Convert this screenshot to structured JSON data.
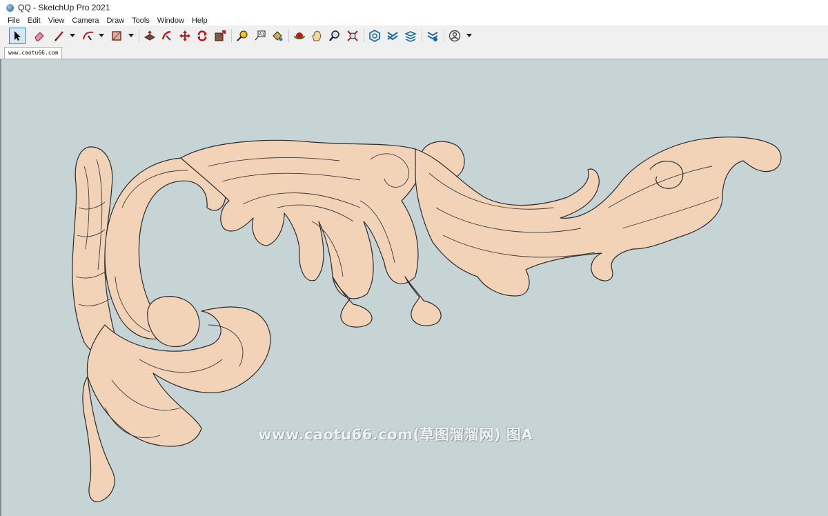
{
  "window": {
    "title": "QQ - SketchUp Pro 2021"
  },
  "menu": [
    "File",
    "Edit",
    "View",
    "Camera",
    "Draw",
    "Tools",
    "Window",
    "Help"
  ],
  "toolbar": {
    "tools": [
      {
        "name": "select-tool-icon",
        "selected": true
      },
      {
        "name": "eraser-tool-icon"
      },
      {
        "name": "line-tool-icon",
        "dropdown": true
      },
      {
        "name": "arc-tool-icon",
        "dropdown": true
      },
      {
        "name": "rectangle-tool-icon",
        "dropdown": true
      },
      {
        "name": "push-pull-tool-icon"
      },
      {
        "name": "follow-me-tool-icon"
      },
      {
        "name": "move-tool-icon"
      },
      {
        "name": "rotate-tool-icon"
      },
      {
        "name": "scale-tool-icon"
      },
      {
        "name": "tape-measure-tool-icon"
      },
      {
        "name": "text-tool-icon"
      },
      {
        "name": "paint-bucket-tool-icon"
      },
      {
        "name": "orbit-tool-icon"
      },
      {
        "name": "pan-tool-icon"
      },
      {
        "name": "zoom-tool-icon"
      },
      {
        "name": "zoom-extents-tool-icon"
      },
      {
        "name": "warehouse-icon"
      },
      {
        "name": "extension-warehouse-icon"
      },
      {
        "name": "layout-icon"
      },
      {
        "name": "extension-manager-icon"
      },
      {
        "name": "account-icon",
        "dropdown": true
      }
    ]
  },
  "scene_tab": {
    "label": "www.caotu66.com"
  },
  "viewport": {
    "background": "#c7d4d6",
    "model_color": "#f2d3b8",
    "edge_color": "#2a2a2a"
  },
  "watermark": {
    "text": "www.caotu66.com(草图溜溜网) 图A"
  }
}
